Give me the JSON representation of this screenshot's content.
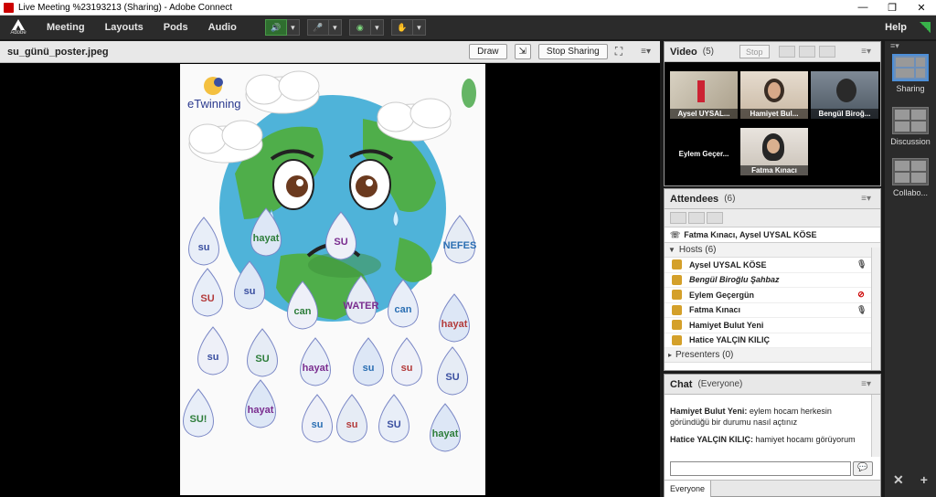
{
  "window": {
    "title": "Live Meeting %23193213 (Sharing) - Adobe Connect",
    "minimize": "—",
    "maximize": "❐",
    "close": "✕"
  },
  "menubar": {
    "logo_text": "Adobe",
    "items": [
      "Meeting",
      "Layouts",
      "Pods",
      "Audio"
    ],
    "help": "Help"
  },
  "share_pod": {
    "title": "su_günü_poster.jpeg",
    "draw_label": "Draw",
    "stop_sharing_label": "Stop Sharing",
    "menu": "≡▾"
  },
  "poster": {
    "logo_text": "eTwinning",
    "drop_words": [
      "su",
      "hayat",
      "SU",
      "NEFES",
      "SU",
      "su",
      "can",
      "WATER",
      "can",
      "hayat",
      "su",
      "SU",
      "hayat",
      "su",
      "su",
      "SU",
      "SU!",
      "hayat",
      "su",
      "su",
      "SU",
      "hayat"
    ]
  },
  "video_pod": {
    "title": "Video",
    "count": "(5)",
    "stop_label": "Stop",
    "menu": "≡▾",
    "tiles": [
      {
        "name": "Aysel UYSAL..."
      },
      {
        "name": "Hamiyet Bul..."
      },
      {
        "name": "Bengül Biroğ..."
      },
      {
        "name": "Eylem Geçer..."
      },
      {
        "name": "Fatma Kınacı"
      }
    ]
  },
  "attendees_pod": {
    "title": "Attendees",
    "count": "(6)",
    "menu": "≡▾",
    "speaking": "Fatma Kınacı, Aysel UYSAL KÖSE",
    "hosts_label": "Hosts (6)",
    "presenters_label": "Presenters (0)",
    "hosts": [
      {
        "name": "Aysel UYSAL KÖSE",
        "italic": false,
        "mic": "on"
      },
      {
        "name": "Bengül Biroğlu Şahbaz",
        "italic": true,
        "mic": "none"
      },
      {
        "name": "Eylem Geçergün",
        "italic": false,
        "mic": "off"
      },
      {
        "name": "Fatma Kınacı",
        "italic": false,
        "mic": "on"
      },
      {
        "name": "Hamiyet Bulut Yeni",
        "italic": false,
        "mic": "none"
      },
      {
        "name": "Hatice YALÇIN KILIÇ",
        "italic": false,
        "mic": "none"
      }
    ]
  },
  "chat_pod": {
    "title": "Chat",
    "scope": "(Everyone)",
    "menu": "≡▾",
    "messages": [
      {
        "sender": "Hamiyet Bulut Yeni:",
        "text": " eylem hocam herkesin göründüğü bir durumu nasıl açtınız"
      },
      {
        "sender": "Hatice YALÇIN KILIÇ:",
        "text": " hamiyet hocamı görüyorum"
      }
    ],
    "footer_tab": "Everyone",
    "send_icon": "💬"
  },
  "layouts": {
    "items": [
      {
        "label": "Sharing",
        "selected": true
      },
      {
        "label": "Discussion",
        "selected": false
      },
      {
        "label": "Collabo...",
        "selected": false
      }
    ]
  },
  "colors": {
    "accent": "#4d8fd8",
    "host_badge": "#d4a02a",
    "mic_off": "#cc0000",
    "green_status": "#38b34a"
  }
}
